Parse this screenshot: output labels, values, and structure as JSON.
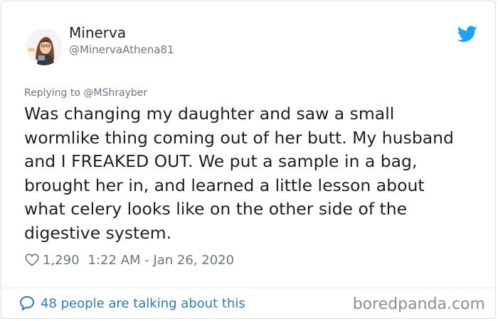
{
  "user": {
    "display_name": "Minerva",
    "handle": "@MinervaAthena81"
  },
  "reply": {
    "prefix": "Replying to ",
    "mention": "@MShrayber"
  },
  "tweet": {
    "text": "Was changing my daughter and saw a small\nwormlike thing coming out of her butt. My husband\nand I FREAKED OUT. We put a sample in a bag,\nbrought her in, and learned a little lesson about\nwhat celery looks like on the other side of the\ndigestive system."
  },
  "meta": {
    "likes": "1,290",
    "timestamp": "1:22 AM - Jan 26, 2020"
  },
  "footer": {
    "talking_text": "48 people are talking about this",
    "watermark": "boredpanda.com"
  },
  "icons": {
    "brand": "twitter-bird-icon",
    "like": "heart-outline-icon",
    "conversation": "speech-bubble-icon"
  },
  "colors": {
    "text": "#1c2022",
    "secondary": "#6b7780",
    "link": "#2b7bb9",
    "twitter_blue": "#1da1f2",
    "watermark": "#8e8e8e"
  }
}
